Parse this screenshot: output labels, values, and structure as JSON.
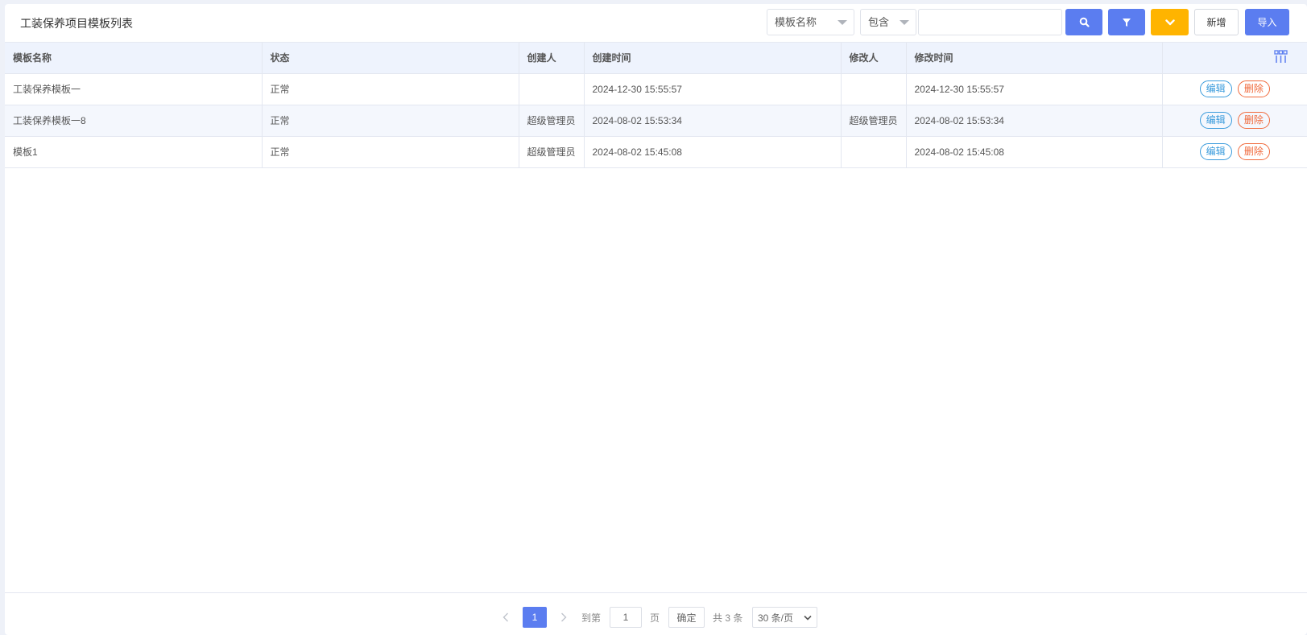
{
  "header": {
    "title": "工装保养项目模板列表",
    "field_select": "模板名称",
    "op_select": "包含",
    "search_value": "",
    "add_label": "新增",
    "import_label": "导入"
  },
  "table": {
    "columns": [
      "模板名称",
      "状态",
      "创建人",
      "创建时间",
      "修改人",
      "修改时间"
    ],
    "rows": [
      {
        "name": "工装保养模板一",
        "status": "正常",
        "creator": "",
        "created": "2024-12-30 15:55:57",
        "modifier": "",
        "modified": "2024-12-30 15:55:57"
      },
      {
        "name": "工装保养模板一8",
        "status": "正常",
        "creator": "超级管理员",
        "created": "2024-08-02 15:53:34",
        "modifier": "超级管理员",
        "modified": "2024-08-02 15:53:34"
      },
      {
        "name": "模板1",
        "status": "正常",
        "creator": "超级管理员",
        "created": "2024-08-02 15:45:08",
        "modifier": "",
        "modified": "2024-08-02 15:45:08"
      }
    ],
    "edit_label": "编辑",
    "delete_label": "删除"
  },
  "pagination": {
    "current_page": "1",
    "goto_label": "到第",
    "goto_value": "1",
    "page_suffix": "页",
    "confirm_label": "确定",
    "total_text": "共 3 条",
    "page_size": "30 条/页"
  },
  "colors": {
    "primary": "#5b7df0",
    "warning": "#ffb400",
    "edit": "#3a9bdc",
    "delete": "#f06a3c",
    "header_bg": "#eef3fd"
  }
}
